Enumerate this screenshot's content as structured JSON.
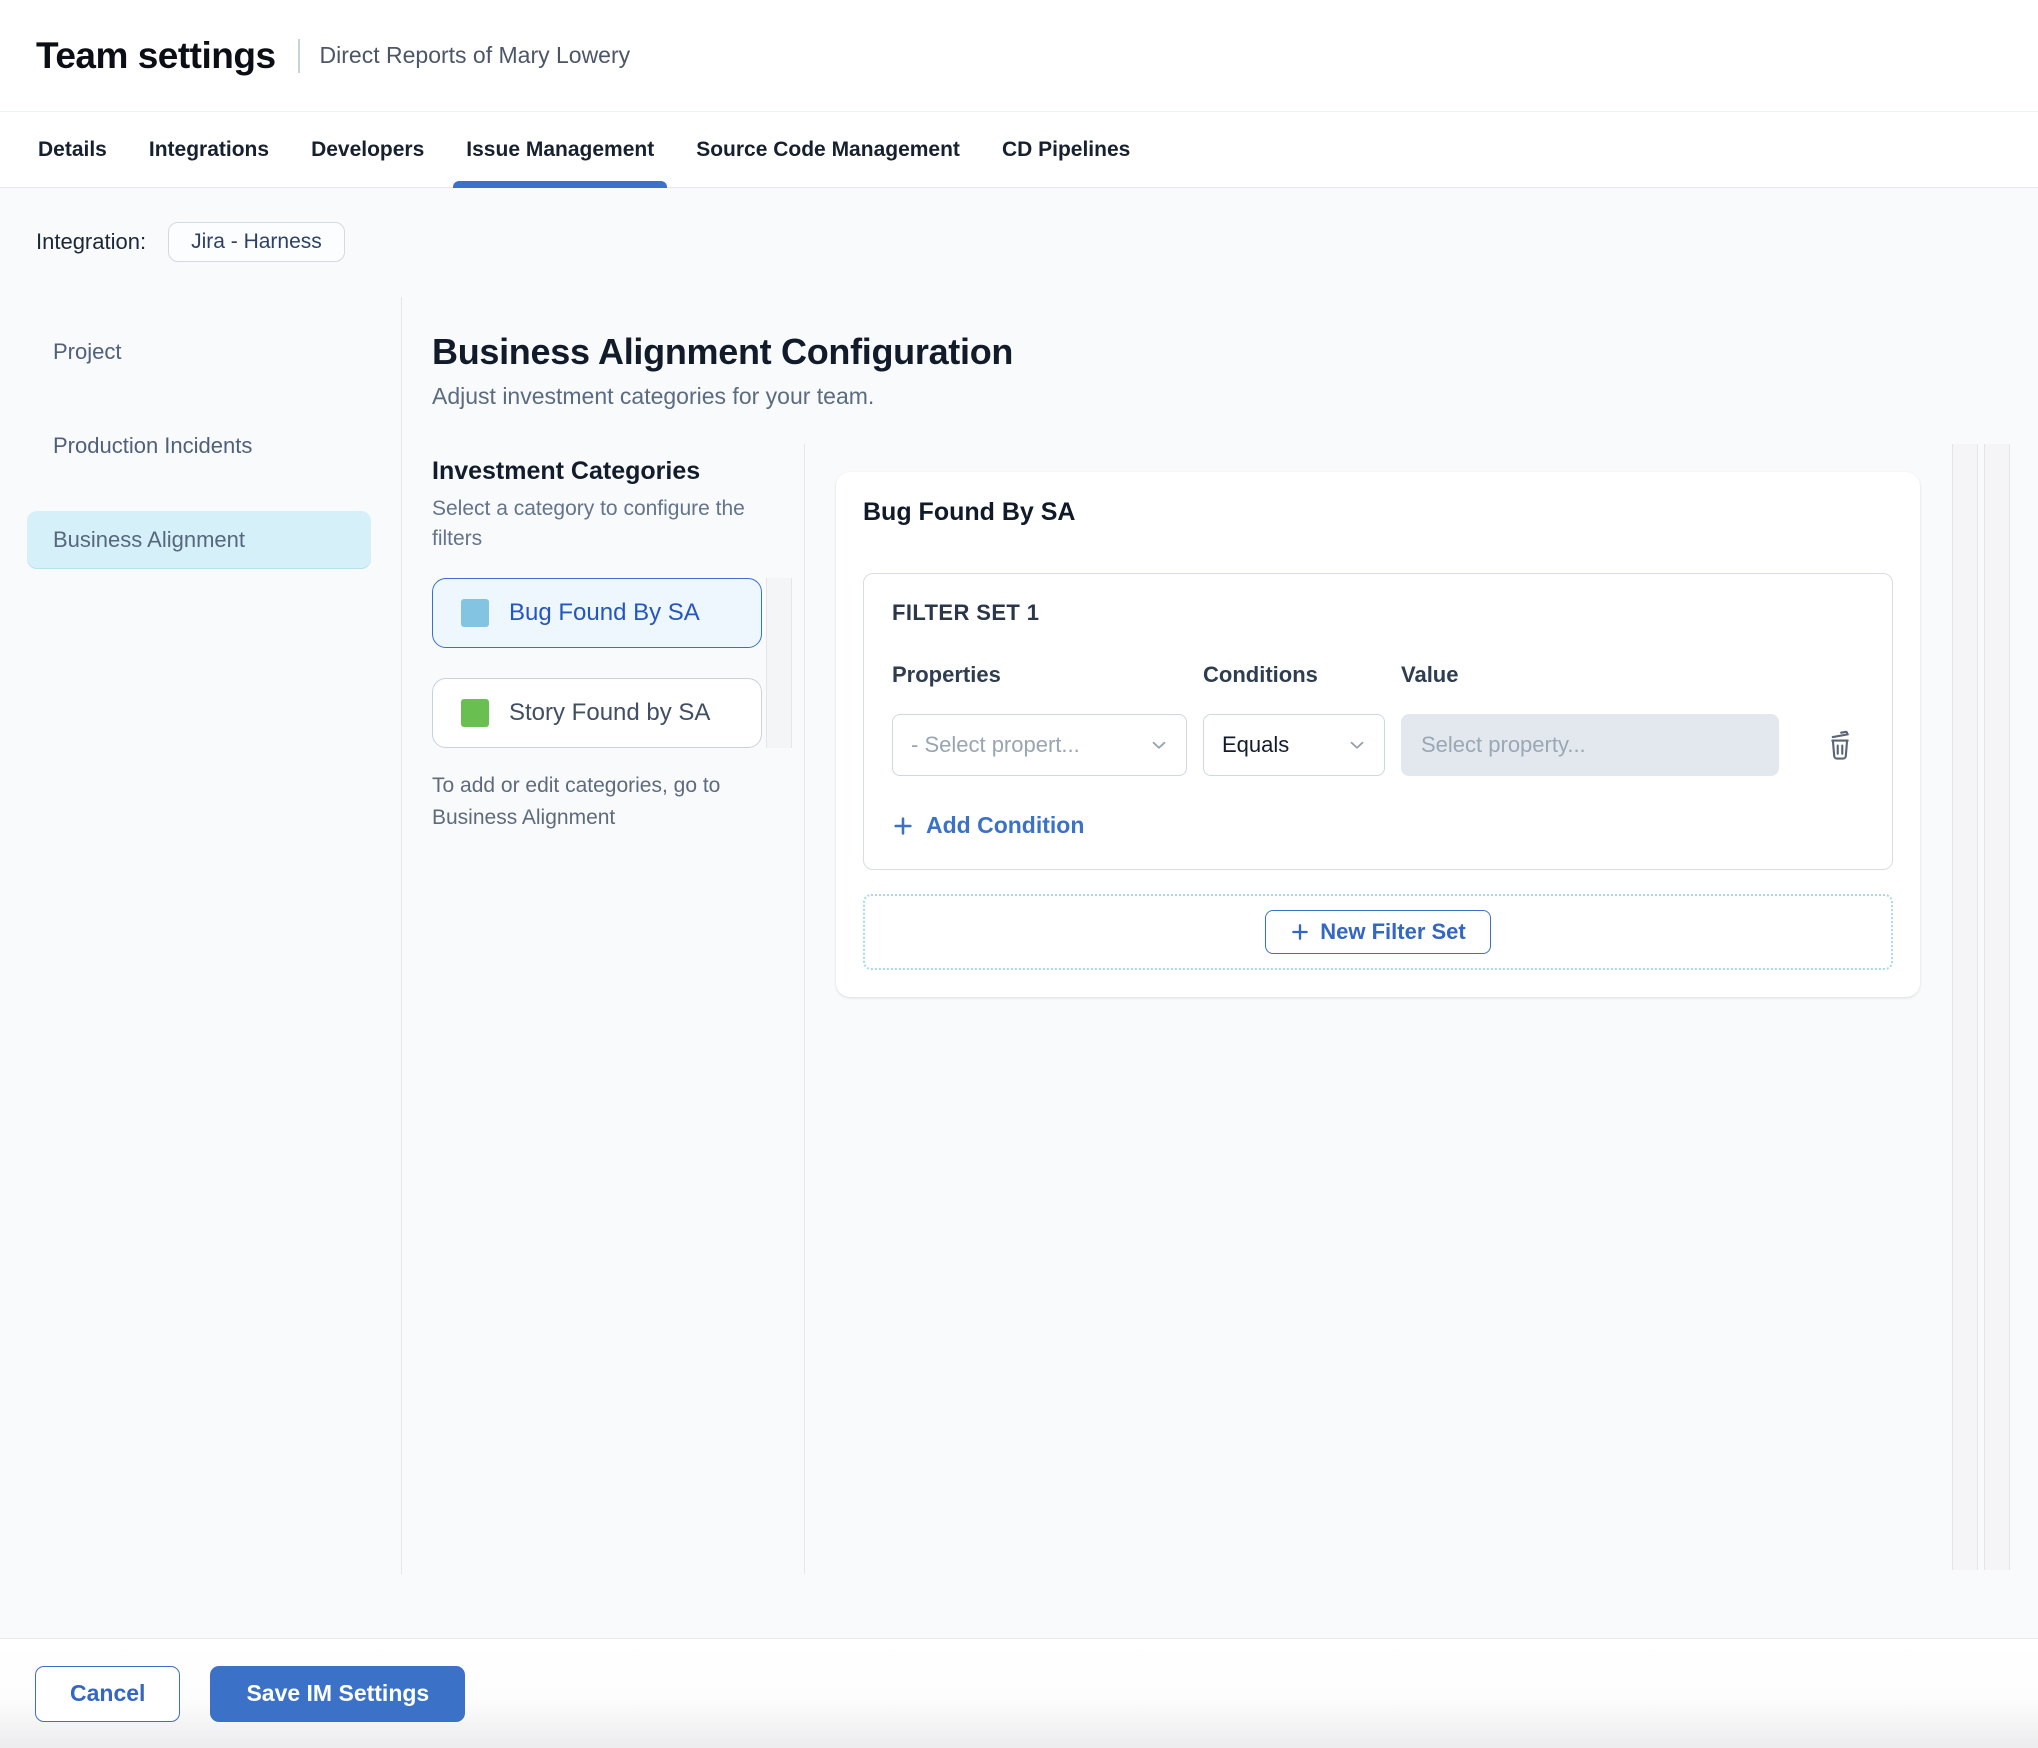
{
  "header": {
    "title": "Team settings",
    "subtitle": "Direct Reports of Mary Lowery"
  },
  "tabs": {
    "items": [
      {
        "label": "Details",
        "active": false
      },
      {
        "label": "Integrations",
        "active": false
      },
      {
        "label": "Developers",
        "active": false
      },
      {
        "label": "Issue Management",
        "active": true
      },
      {
        "label": "Source Code Management",
        "active": false
      },
      {
        "label": "CD Pipelines",
        "active": false
      }
    ]
  },
  "integration": {
    "label": "Integration:",
    "value": "Jira - Harness"
  },
  "sidebar": {
    "items": [
      {
        "label": "Project",
        "selected": false
      },
      {
        "label": "Production Incidents",
        "selected": false
      },
      {
        "label": "Business Alignment",
        "selected": true
      }
    ]
  },
  "main": {
    "title": "Business Alignment Configuration",
    "subtitle": "Adjust investment categories for your team.",
    "categories": {
      "heading": "Investment Categories",
      "caption": "Select a category to configure the filters",
      "items": [
        {
          "label": "Bug Found By SA",
          "color": "#82c4e2",
          "selected": true
        },
        {
          "label": "Story Found by SA",
          "color": "#6abf51",
          "selected": false
        }
      ],
      "note": "To add or edit categories, go to Business Alignment"
    },
    "panel": {
      "title": "Bug Found By SA",
      "filter_set": {
        "label": "FILTER SET 1",
        "columns": [
          "Properties",
          "Conditions",
          "Value"
        ],
        "property_placeholder": "- Select propert...",
        "condition_value": "Equals",
        "value_placeholder": "Select property...",
        "add_condition_label": "Add Condition"
      },
      "new_filter_set_label": "New Filter Set"
    }
  },
  "footer": {
    "cancel_label": "Cancel",
    "save_label": "Save IM Settings"
  },
  "colors": {
    "primary": "#3b72c8",
    "sidebar_selected_bg": "#d6f0f9",
    "category_selected_bg": "#eef7fd",
    "dashed_border": "#a9d7ec"
  }
}
